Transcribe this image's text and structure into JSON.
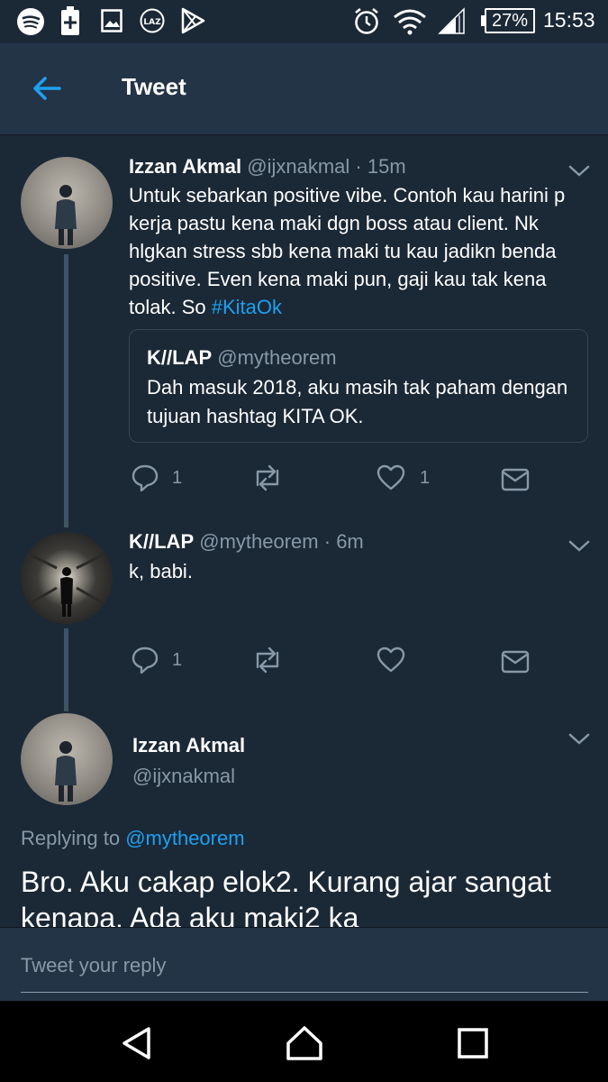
{
  "status_bar": {
    "battery": "27%",
    "time": "15:53",
    "left_icons": [
      "spotify-icon",
      "battery-plus-icon",
      "image-icon",
      "laz-icon",
      "play-store-icon"
    ],
    "right_icons": [
      "alarm-icon",
      "wifi-icon",
      "signal-icon",
      "battery-icon"
    ]
  },
  "app_bar": {
    "title": "Tweet"
  },
  "tweets": [
    {
      "display_name": "Izzan Akmal",
      "handle": "@ijxnakmal",
      "time": "· 15m",
      "text": "Untuk sebarkan positive vibe. Contoh kau harini p kerja pastu kena maki dgn boss atau client. Nk hlgkan stress sbb kena maki tu kau jadikn benda positive. Even kena maki pun, gaji kau tak kena tolak. So ",
      "hashtag": "#KitaOk",
      "quote": {
        "display_name": "K//LAP",
        "handle": "@mytheorem",
        "text": "Dah masuk 2018, aku masih tak paham dengan tujuan hashtag KITA OK."
      },
      "reply_count": "1",
      "like_count": "1"
    },
    {
      "display_name": "K//LAP",
      "handle": "@mytheorem",
      "time": "· 6m",
      "text": "k, babi.",
      "reply_count": "1",
      "like_count": ""
    }
  ],
  "focused_tweet": {
    "display_name": "Izzan Akmal",
    "handle": "@ijxnakmal",
    "replying_prefix": "Replying to ",
    "replying_to": "@mytheorem",
    "text": "Bro. Aku cakap elok2. Kurang ajar sangat kenapa. Ada aku maki2 ka"
  },
  "reply_bar": {
    "placeholder": "Tweet your reply"
  },
  "colors": {
    "background": "#1b2836",
    "bar": "#243447",
    "accent": "#1da1f2",
    "muted": "#8899a6"
  }
}
